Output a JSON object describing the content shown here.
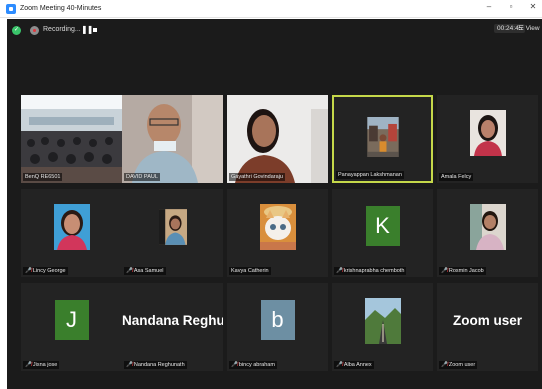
{
  "window": {
    "title": "Zoom Meeting 40-Minutes",
    "controls": [
      "–",
      "▫",
      "✕"
    ]
  },
  "toolbar": {
    "security_icon": "shield-check-icon",
    "recording_label": "Recording...",
    "pause_glyph": "❚❚",
    "timer": "00:24:45",
    "view_label": "☷ View"
  },
  "participants": [
    {
      "name": "BenQ RE6501",
      "type": "video",
      "muted": false
    },
    {
      "name": "DAVID PAUL",
      "type": "video",
      "muted": false
    },
    {
      "name": "Gayathri Govindaraju",
      "type": "video",
      "muted": false
    },
    {
      "name": "Panayappan Lakshmanan",
      "type": "photo",
      "muted": false,
      "active": true
    },
    {
      "name": "Amala Felcy",
      "type": "photo",
      "muted": false
    },
    {
      "name": "Lincy George",
      "type": "photo",
      "muted": true
    },
    {
      "name": "Asa Samuel",
      "type": "photo",
      "muted": true
    },
    {
      "name": "Kavya Catherin",
      "type": "photo",
      "muted": false
    },
    {
      "name": "krishnaprabha chemboth",
      "type": "letter",
      "letter": "K",
      "color": "#3a7f2c",
      "muted": true
    },
    {
      "name": "Rosmin Jacob",
      "type": "photo",
      "muted": true
    },
    {
      "name": "Jisna jose",
      "type": "letter",
      "letter": "J",
      "color": "#3a7f2c",
      "muted": true
    },
    {
      "name": "Nandana Reghunath",
      "type": "name",
      "display": "Nandana  Reghu...",
      "muted": true
    },
    {
      "name": "bincy abraham",
      "type": "letter",
      "letter": "b",
      "color": "#6d8fa3",
      "muted": true
    },
    {
      "name": "Alba Annex",
      "type": "photo",
      "muted": true
    },
    {
      "name": "Zoom user",
      "type": "name",
      "display": "Zoom user",
      "muted": true
    }
  ]
}
